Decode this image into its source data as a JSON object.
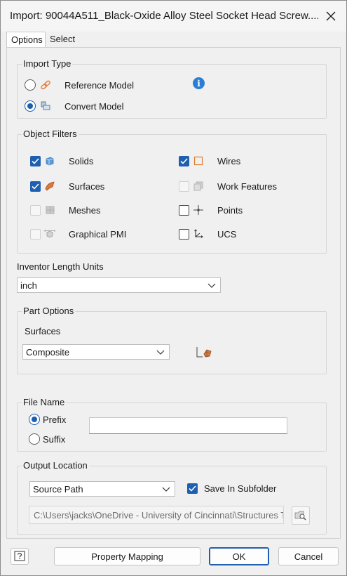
{
  "dialog": {
    "title": "Import: 90044A511_Black-Oxide Alloy Steel Socket Head Screw...."
  },
  "tabs": [
    {
      "label": "Options",
      "active": true
    },
    {
      "label": "Select",
      "active": false
    }
  ],
  "import_type": {
    "group_label": "Import Type",
    "options": [
      {
        "label": "Reference Model",
        "selected": false,
        "icon": "chain-link-icon"
      },
      {
        "label": "Convert Model",
        "selected": true,
        "icon": "convert-model-icon"
      }
    ],
    "info_icon": "info-icon"
  },
  "object_filters": {
    "group_label": "Object Filters",
    "items": [
      {
        "label": "Solids",
        "checked": true,
        "enabled": true,
        "icon": "solid-cube-icon"
      },
      {
        "label": "Wires",
        "checked": true,
        "enabled": true,
        "icon": "wire-square-icon"
      },
      {
        "label": "Surfaces",
        "checked": true,
        "enabled": true,
        "icon": "surface-icon"
      },
      {
        "label": "Work Features",
        "checked": false,
        "enabled": false,
        "icon": "work-features-icon"
      },
      {
        "label": "Meshes",
        "checked": false,
        "enabled": false,
        "icon": "mesh-icon"
      },
      {
        "label": "Points",
        "checked": false,
        "enabled": true,
        "icon": "point-crosshair-icon"
      },
      {
        "label": "Graphical PMI",
        "checked": false,
        "enabled": false,
        "icon": "graphical-pmi-icon"
      },
      {
        "label": "UCS",
        "checked": false,
        "enabled": true,
        "icon": "ucs-axes-icon"
      }
    ]
  },
  "length_units": {
    "label": "Inventor Length Units",
    "value": "inch"
  },
  "part_options": {
    "group_label": "Part Options",
    "surfaces_label": "Surfaces",
    "surfaces_value": "Composite",
    "icon": "composite-surface-icon"
  },
  "file_name": {
    "group_label": "File Name",
    "options": [
      {
        "label": "Prefix",
        "selected": true
      },
      {
        "label": "Suffix",
        "selected": false
      }
    ],
    "value": ""
  },
  "output_location": {
    "group_label": "Output Location",
    "location_value": "Source Path",
    "save_in_subfolder_label": "Save In Subfolder",
    "save_in_subfolder_checked": true,
    "path": "C:\\Users\\jacks\\OneDrive - University of Cincinnati\\Structures T",
    "browse_icon": "browse-folder-icon"
  },
  "footer": {
    "help_icon": "help-icon",
    "property_mapping_label": "Property Mapping",
    "ok_label": "OK",
    "cancel_label": "Cancel"
  },
  "colors": {
    "accent": "#1f5fb0",
    "info": "#2a7fd4",
    "wire_orange": "#e07a30"
  }
}
